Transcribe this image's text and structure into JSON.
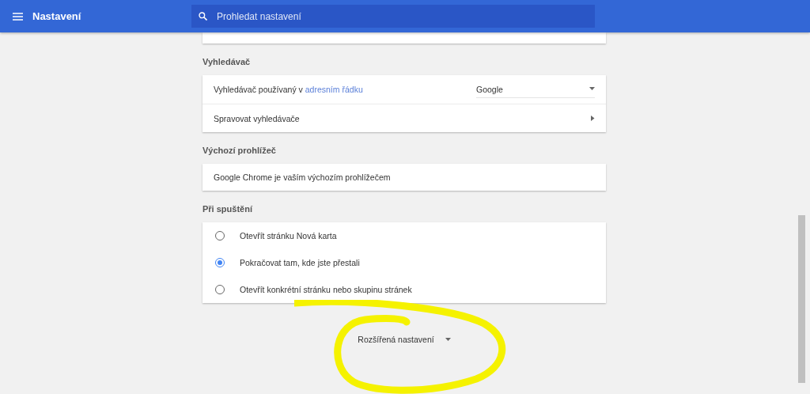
{
  "header": {
    "title": "Nastavení",
    "search": {
      "placeholder": "Prohledat nastavení"
    }
  },
  "sections": [
    {
      "heading": "Vyhledávač",
      "rows": [
        {
          "kind": "select",
          "prefix": "Vyhledávač používaný v ",
          "link": "adresním řádku",
          "value": "Google"
        },
        {
          "kind": "submenu",
          "label": "Spravovat vyhledávače"
        }
      ]
    },
    {
      "heading": "Výchozí prohlížeč",
      "rows": [
        {
          "kind": "text",
          "label": "Google Chrome je vaším výchozím prohlížečem"
        }
      ]
    },
    {
      "heading": "Při spuštění",
      "rows": [
        {
          "kind": "radio",
          "label": "Otevřít stránku Nová karta",
          "selected": false
        },
        {
          "kind": "radio",
          "label": "Pokračovat tam, kde jste přestali",
          "selected": true
        },
        {
          "kind": "radio",
          "label": "Otevřít konkrétní stránku nebo skupinu stránek",
          "selected": false
        }
      ]
    }
  ],
  "advanced": {
    "label": "Rozšířená nastavení"
  }
}
